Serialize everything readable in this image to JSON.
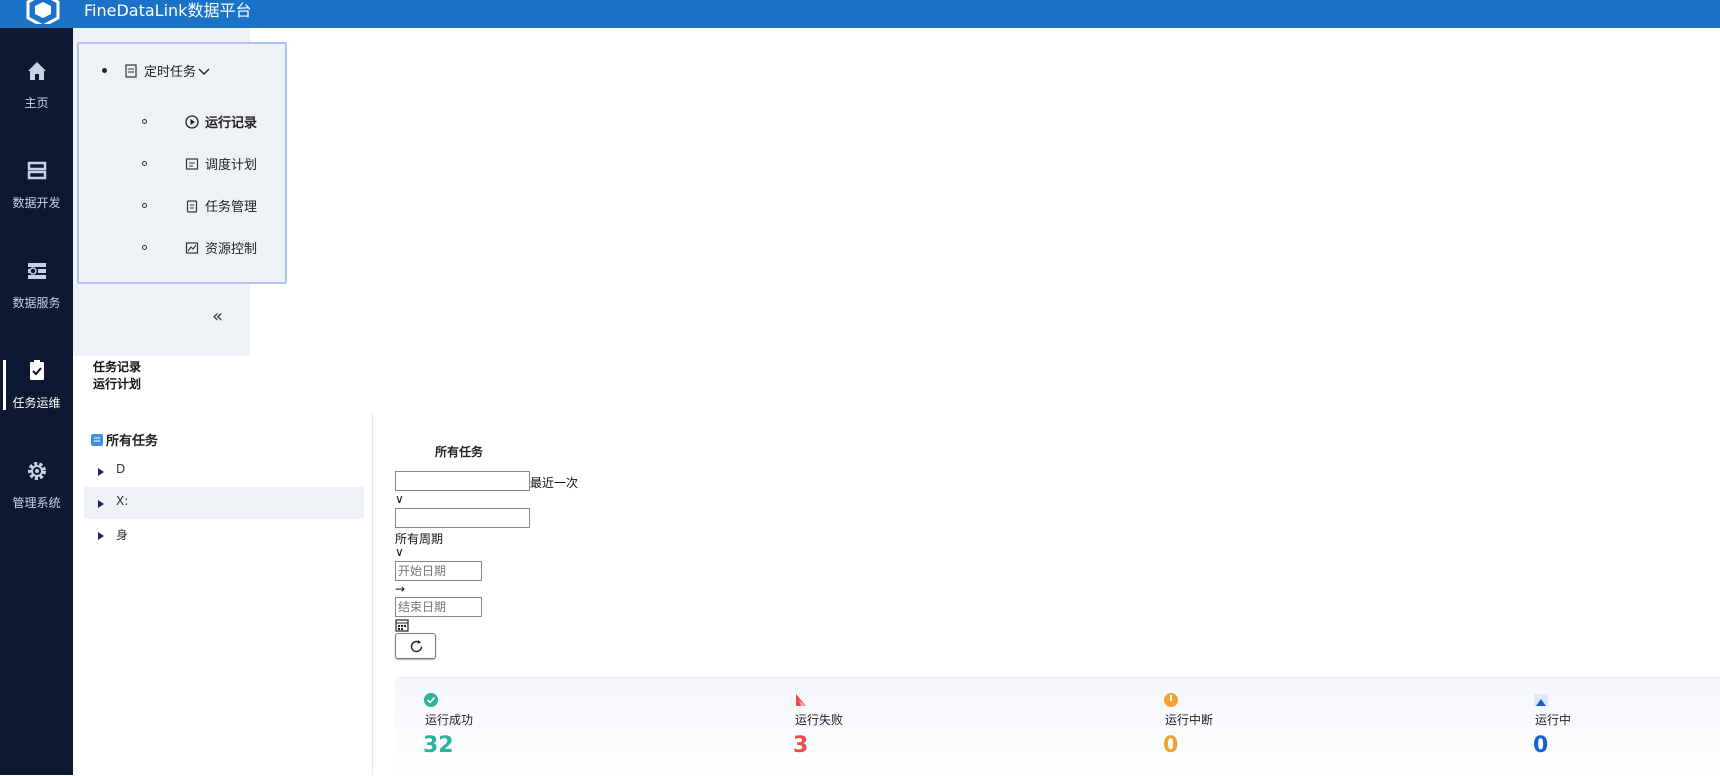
{
  "app": {
    "title": "FineDataLink数据平台"
  },
  "nav": {
    "items": [
      {
        "label": "主页",
        "icon": "home-icon"
      },
      {
        "label": "数据开发",
        "icon": "data-dev-icon"
      },
      {
        "label": "数据服务",
        "icon": "data-service-icon"
      },
      {
        "label": "任务运维",
        "icon": "task-ops-icon",
        "active": true
      },
      {
        "label": "管理系统",
        "icon": "gear-icon"
      }
    ]
  },
  "submenu": {
    "group": "定时任务",
    "items": [
      {
        "label": "运行记录",
        "icon": "play-circle-icon",
        "active": true
      },
      {
        "label": "调度计划",
        "icon": "schedule-icon"
      },
      {
        "label": "任务管理",
        "icon": "task-manage-icon"
      },
      {
        "label": "资源控制",
        "icon": "resource-control-icon"
      }
    ],
    "collapse": "«"
  },
  "tabs": [
    "任务记录",
    "运行计划"
  ],
  "tree": {
    "root": "所有任务",
    "nodes": [
      "D",
      "X:",
      "身"
    ]
  },
  "filters": {
    "title": "所有任务",
    "input1_value": "",
    "recent_label": "最近一次",
    "chevron": "∨",
    "input2_value": "",
    "cycle_label": "所有周期",
    "start_placeholder": "开始日期",
    "arrow": "→",
    "end_placeholder": "结束日期"
  },
  "stats": [
    {
      "label": "运行成功",
      "value": "32",
      "color": "#2bb39b",
      "icon": "success-icon"
    },
    {
      "label": "运行失败",
      "value": "3",
      "color": "#e84c4c",
      "icon": "fail-icon"
    },
    {
      "label": "运行中断",
      "value": "0",
      "color": "#f2a230",
      "icon": "interrupt-icon"
    },
    {
      "label": "运行中",
      "value": "0",
      "color": "#1b5fd0",
      "icon": "running-icon"
    }
  ]
}
